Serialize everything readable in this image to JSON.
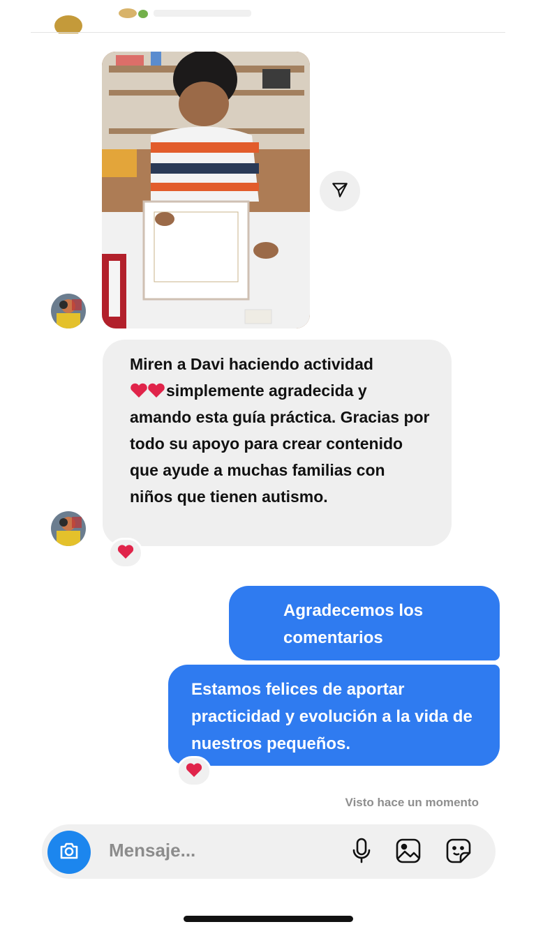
{
  "thread": {
    "incoming_message": {
      "text_line_1": "Miren a Davi haciendo actividad",
      "text_line_2_after_hearts": "simplemente agradecida y",
      "text_rest": "amando esta guía práctica. Gracias por todo su apoyo para crear contenido que ayude a muchas familias con niños que tienen autismo.",
      "reaction": "❤️"
    },
    "outgoing_messages": [
      {
        "text": "Agradecemos los comentarios"
      },
      {
        "text": "Estamos felices de aportar practicidad y evolución a la vida de nuestros pequeños.",
        "reaction": "❤️"
      }
    ],
    "seen_status": "Visto hace un momento"
  },
  "composer": {
    "placeholder": "Mensaje..."
  },
  "icons": {
    "share": "paper-plane-icon",
    "camera": "camera-icon",
    "mic": "microphone-icon",
    "gallery": "image-gallery-icon",
    "sticker": "sticker-icon"
  },
  "colors": {
    "outgoing_bubble": "#2f7bf0",
    "incoming_bubble": "#efefef",
    "camera_button": "#1c86ee",
    "heart": "#e0244a"
  }
}
